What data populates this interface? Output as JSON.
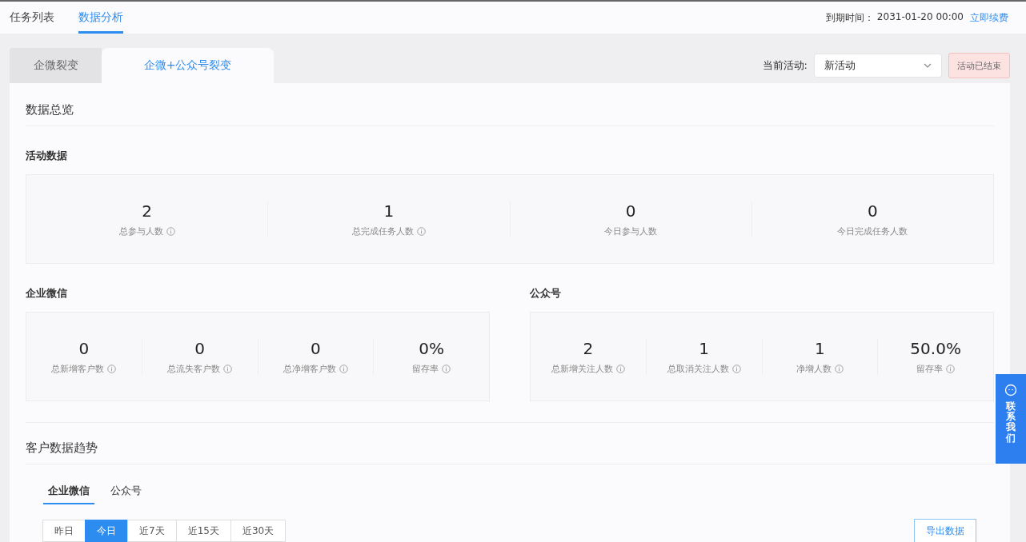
{
  "nav": {
    "tabs": [
      {
        "label": "任务列表",
        "selected": false
      },
      {
        "label": "数据分析",
        "selected": true
      }
    ],
    "expire_label": "到期时间：",
    "expire_date": "2031-01-20 00:00",
    "renew_link": "立即续费"
  },
  "mode_tabs": [
    {
      "label": "企微裂变",
      "selected": false
    },
    {
      "label": "企微+公众号裂变",
      "selected": true
    }
  ],
  "activity": {
    "label": "当前活动:",
    "value": "新活动",
    "status_button": "活动已结束"
  },
  "overview_title": "数据总览",
  "activity_data": {
    "title": "活动数据",
    "stats": [
      {
        "value": "2",
        "label": "总参与人数",
        "info": true
      },
      {
        "value": "1",
        "label": "总完成任务人数",
        "info": true
      },
      {
        "value": "0",
        "label": "今日参与人数",
        "info": false
      },
      {
        "value": "0",
        "label": "今日完成任务人数",
        "info": false
      }
    ]
  },
  "wecom": {
    "title": "企业微信",
    "stats": [
      {
        "value": "0",
        "label": "总新增客户数",
        "info": true
      },
      {
        "value": "0",
        "label": "总流失客户数",
        "info": true
      },
      {
        "value": "0",
        "label": "总净增客户数",
        "info": true
      },
      {
        "value": "0%",
        "label": "留存率",
        "info": true
      }
    ]
  },
  "official": {
    "title": "公众号",
    "stats": [
      {
        "value": "2",
        "label": "总新增关注人数",
        "info": true
      },
      {
        "value": "1",
        "label": "总取消关注人数",
        "info": true
      },
      {
        "value": "1",
        "label": "净增人数",
        "info": true
      },
      {
        "value": "50.0%",
        "label": "留存率",
        "info": true
      }
    ]
  },
  "trend": {
    "title": "客户数据趋势",
    "tabs": [
      {
        "label": "企业微信",
        "selected": true
      },
      {
        "label": "公众号",
        "selected": false
      }
    ],
    "ranges": [
      {
        "label": "昨日",
        "selected": false
      },
      {
        "label": "今日",
        "selected": true
      },
      {
        "label": "近7天",
        "selected": false
      },
      {
        "label": "近15天",
        "selected": false
      },
      {
        "label": "近30天",
        "selected": false
      }
    ],
    "export_button": "导出数据"
  },
  "contact": "联系我们"
}
